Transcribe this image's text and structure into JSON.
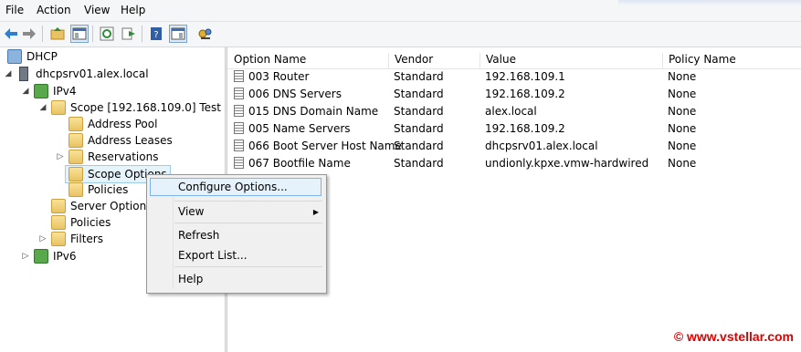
{
  "menu": [
    "File",
    "Action",
    "View",
    "Help"
  ],
  "toolbar_icons": [
    "back-icon",
    "forward-icon",
    "up-folder-icon",
    "show-hide-tree-icon",
    "refresh-icon",
    "export-list-icon",
    "help-icon",
    "properties-icon",
    "snapin-icon"
  ],
  "tree": {
    "root": "DHCP",
    "server": "dhcpsrv01.alex.local",
    "ipv4": "IPv4",
    "scope": "Scope [192.168.109.0] Test",
    "address_pool": "Address Pool",
    "address_leases": "Address Leases",
    "reservations": "Reservations",
    "scope_options": "Scope Options",
    "policies_scope": "Policies",
    "server_options": "Server Options",
    "policies": "Policies",
    "filters": "Filters",
    "ipv6": "IPv6"
  },
  "columns": [
    "Option Name",
    "Vendor",
    "Value",
    "Policy Name"
  ],
  "rows": [
    {
      "name": "003 Router",
      "vendor": "Standard",
      "value": "192.168.109.1",
      "policy": "None"
    },
    {
      "name": "006 DNS Servers",
      "vendor": "Standard",
      "value": "192.168.109.2",
      "policy": "None"
    },
    {
      "name": "015 DNS Domain Name",
      "vendor": "Standard",
      "value": "alex.local",
      "policy": "None"
    },
    {
      "name": "005 Name Servers",
      "vendor": "Standard",
      "value": "192.168.109.2",
      "policy": "None"
    },
    {
      "name": "066 Boot Server Host Name",
      "vendor": "Standard",
      "value": "dhcpsrv01.alex.local",
      "policy": "None"
    },
    {
      "name": "067 Bootfile Name",
      "vendor": "Standard",
      "value": "undionly.kpxe.vmw-hardwired",
      "policy": "None"
    }
  ],
  "context_menu": {
    "configure": "Configure Options...",
    "view": "View",
    "refresh": "Refresh",
    "export": "Export List...",
    "help": "Help"
  },
  "watermark": "© www.vstellar.com"
}
